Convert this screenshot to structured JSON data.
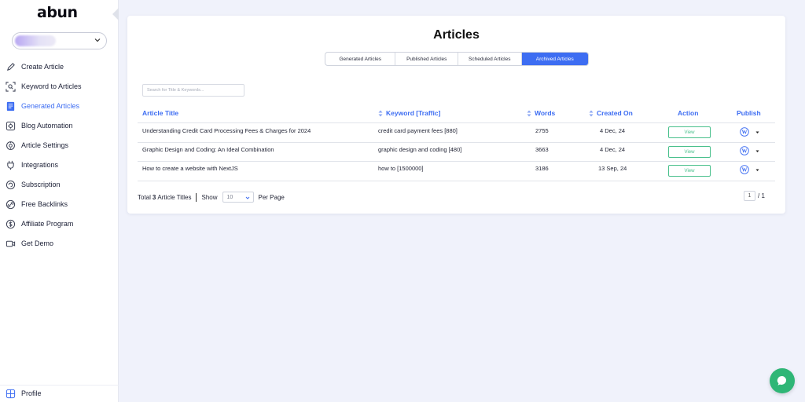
{
  "sidebar": {
    "logo": "abun",
    "items": [
      {
        "label": "Create Article",
        "icon": "pen-icon"
      },
      {
        "label": "Keyword to Articles",
        "icon": "keyword-scan-icon"
      },
      {
        "label": "Generated Articles",
        "icon": "document-icon",
        "active": true
      },
      {
        "label": "Blog Automation",
        "icon": "automation-icon"
      },
      {
        "label": "Article Settings",
        "icon": "settings-icon"
      },
      {
        "label": "Integrations",
        "icon": "plug-icon"
      },
      {
        "label": "Subscription",
        "icon": "subscription-icon"
      },
      {
        "label": "Free Backlinks",
        "icon": "link-icon"
      },
      {
        "label": "Affiliate Program",
        "icon": "dollar-icon"
      },
      {
        "label": "Get Demo",
        "icon": "video-icon"
      }
    ],
    "profile_label": "Profile"
  },
  "main": {
    "title": "Articles",
    "tabs": [
      {
        "label": "Generated Articles",
        "active": false
      },
      {
        "label": "Published Articles",
        "active": false
      },
      {
        "label": "Scheduled Articles",
        "active": false
      },
      {
        "label": "Archived Articles",
        "active": true
      }
    ],
    "search_placeholder": "Search for Title & Keywords...",
    "columns": {
      "title": "Article Title",
      "keyword": "Keyword [Traffic]",
      "words": "Words",
      "created": "Created On",
      "action": "Action",
      "publish": "Publish"
    },
    "rows": [
      {
        "title": "Understanding Credit Card Processing Fees & Charges for 2024",
        "keyword": "credit card payment fees [880]",
        "words": "2755",
        "created": "4 Dec, 24",
        "action": "View"
      },
      {
        "title": "Graphic Design and Coding: An Ideal Combination",
        "keyword": "graphic design and coding [480]",
        "words": "3663",
        "created": "4 Dec, 24",
        "action": "View"
      },
      {
        "title": "How to create a website with NextJS",
        "keyword": "how to [1500000]",
        "words": "3186",
        "created": "13 Sep, 24",
        "action": "View"
      }
    ],
    "footer": {
      "total_prefix": "Total",
      "total_count": "3",
      "total_suffix": "Article Titles",
      "show_label": "Show",
      "page_size": "10",
      "per_page_label": "Per Page",
      "current_page": "1",
      "total_pages": "/ 1"
    }
  },
  "colors": {
    "accent": "#3d6df2",
    "view_green": "#49c08c",
    "chat_green": "#2fb676"
  }
}
